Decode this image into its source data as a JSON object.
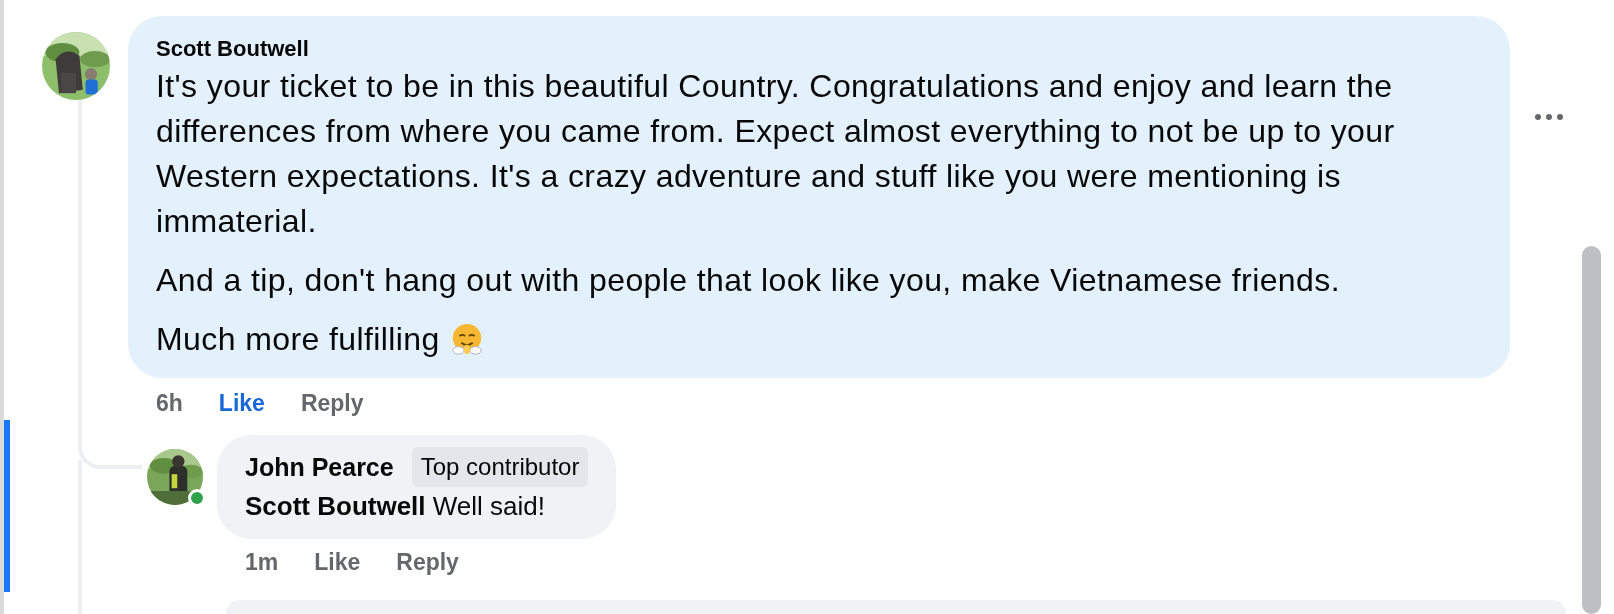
{
  "comments": [
    {
      "author": "Scott Boutwell",
      "paragraphs": [
        "It's your ticket to be in this beautiful Country. Congratulations and enjoy and learn the differences from where you came from. Expect almost everything to not be up to your Western expectations. It's a crazy adventure and stuff like you were mentioning is immaterial.",
        "And a tip, don't hang out with people that look like you, make Vietnamese friends."
      ],
      "closing_line": "Much more fulfilling",
      "time": "6h",
      "like": "Like",
      "liked": true,
      "reply": "Reply",
      "replies": [
        {
          "author": "John Pearce",
          "badge": "Top contributor",
          "paragraphs": [
            "**Scott Boutwell** Well said!"
          ],
          "online": true,
          "time": "1m",
          "like": "Like",
          "liked": false,
          "reply": "Reply"
        }
      ]
    }
  ]
}
